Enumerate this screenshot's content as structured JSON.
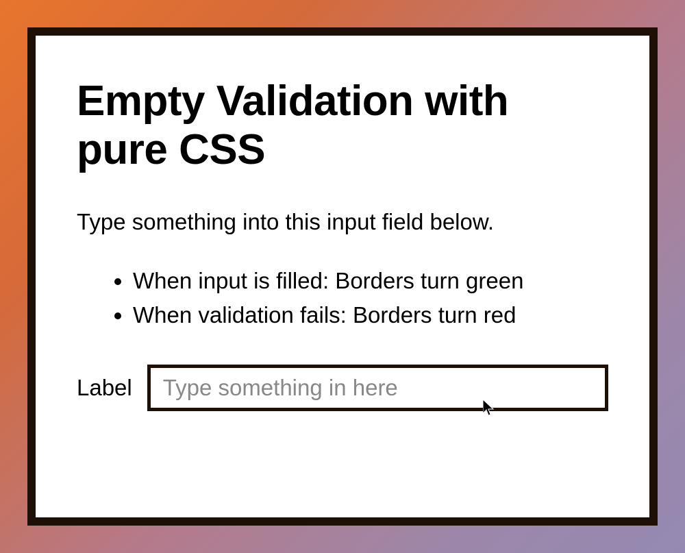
{
  "card": {
    "title": "Empty Validation with pure CSS",
    "subtitle": "Type something into this input field below.",
    "conditions": [
      "When input is filled: Borders turn green",
      "When validation fails: Borders turn red"
    ],
    "form": {
      "label": "Label",
      "placeholder": "Type something in here",
      "value": ""
    }
  },
  "colors": {
    "border_dark": "#1e1007",
    "placeholder": "#888888",
    "gradient_start": "#e8752e",
    "gradient_end": "#9589b3"
  }
}
